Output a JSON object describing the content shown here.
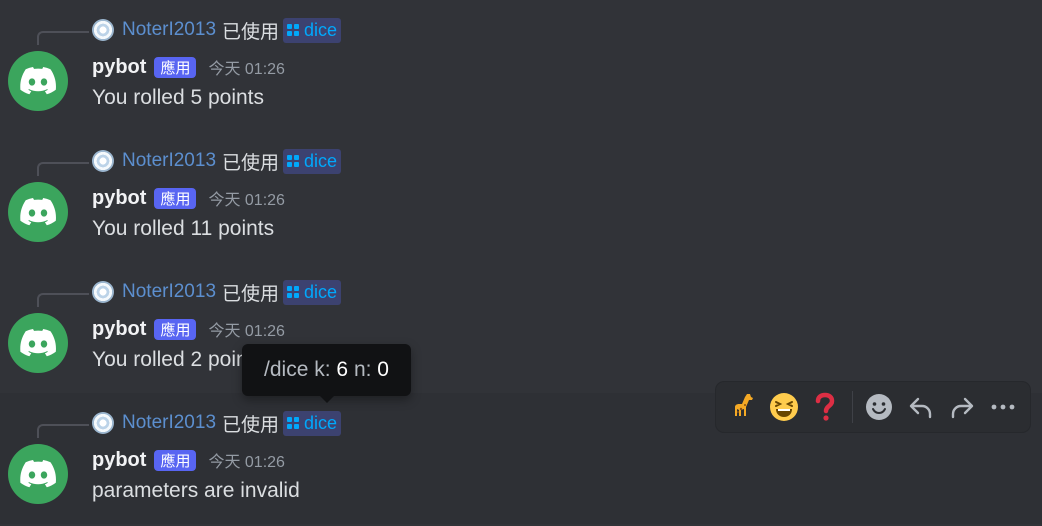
{
  "messages": [
    {
      "reply_user": "NoterI2013",
      "reply_used": "已使用",
      "command": "dice",
      "author": "pybot",
      "badge": "應用",
      "time": "今天 01:26",
      "text": "You rolled 5 points"
    },
    {
      "reply_user": "NoterI2013",
      "reply_used": "已使用",
      "command": "dice",
      "author": "pybot",
      "badge": "應用",
      "time": "今天 01:26",
      "text": "You rolled 11 points"
    },
    {
      "reply_user": "NoterI2013",
      "reply_used": "已使用",
      "command": "dice",
      "author": "pybot",
      "badge": "應用",
      "time": "今天 01:26",
      "text": "You rolled 2 points"
    },
    {
      "reply_user": "NoterI2013",
      "reply_used": "已使用",
      "command": "dice",
      "author": "pybot",
      "badge": "應用",
      "time": "今天 01:26",
      "text": "parameters are invalid"
    }
  ],
  "tooltip": {
    "command": "/dice",
    "k_label": "k:",
    "k_value": "6",
    "n_label": "n:",
    "n_value": "0"
  },
  "toolbar": {
    "reactions": [
      {
        "emoji": "🦒",
        "icon": "giraffe-emoji"
      },
      {
        "emoji": "😆",
        "icon": "laughing-emoji"
      },
      {
        "emoji": "❓",
        "icon": "question-mark-emoji"
      }
    ],
    "actions": [
      "add-reaction-icon",
      "reply-icon",
      "forward-icon",
      "more-icon"
    ]
  },
  "colors": {
    "background": "#313338",
    "accent": "#5865f2",
    "link": "#00a8fc",
    "avatar": "#3ba55d"
  }
}
